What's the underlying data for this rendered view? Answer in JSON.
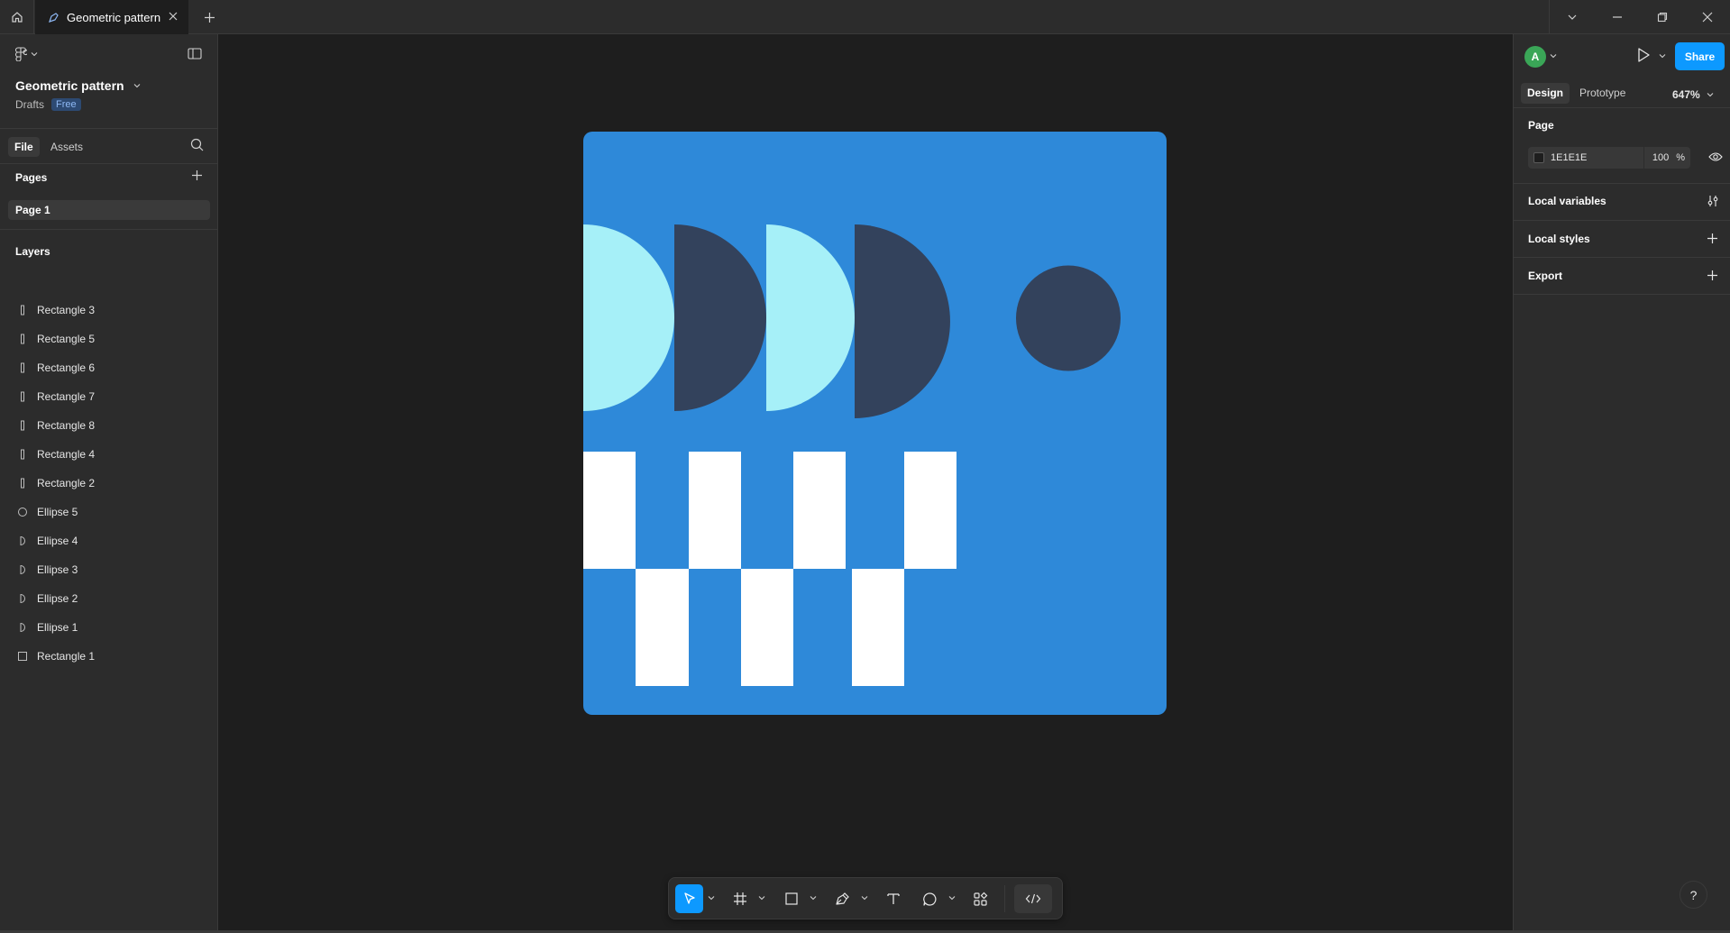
{
  "tabs": {
    "active_title": "Geometric pattern"
  },
  "file": {
    "name": "Geometric pattern",
    "location": "Drafts",
    "plan_badge": "Free"
  },
  "left_tabs": {
    "file": "File",
    "assets": "Assets"
  },
  "pages": {
    "heading": "Pages",
    "items": [
      "Page 1"
    ]
  },
  "layers": {
    "heading": "Layers",
    "items": [
      {
        "name": "Rectangle 3",
        "icon": "rectangle-thin-icon"
      },
      {
        "name": "Rectangle 5",
        "icon": "rectangle-thin-icon"
      },
      {
        "name": "Rectangle 6",
        "icon": "rectangle-thin-icon"
      },
      {
        "name": "Rectangle 7",
        "icon": "rectangle-thin-icon"
      },
      {
        "name": "Rectangle 8",
        "icon": "rectangle-thin-icon"
      },
      {
        "name": "Rectangle 4",
        "icon": "rectangle-thin-icon"
      },
      {
        "name": "Rectangle 2",
        "icon": "rectangle-thin-icon"
      },
      {
        "name": "Ellipse 5",
        "icon": "ellipse-icon"
      },
      {
        "name": "Ellipse 4",
        "icon": "half-ellipse-icon"
      },
      {
        "name": "Ellipse 3",
        "icon": "half-ellipse-icon"
      },
      {
        "name": "Ellipse 2",
        "icon": "half-ellipse-icon"
      },
      {
        "name": "Ellipse 1",
        "icon": "half-ellipse-icon"
      },
      {
        "name": "Rectangle 1",
        "icon": "rectangle-icon"
      }
    ]
  },
  "header": {
    "share_label": "Share",
    "avatar_initial": "A"
  },
  "right_tabs": {
    "design": "Design",
    "prototype": "Prototype",
    "zoom": "647%"
  },
  "page_panel": {
    "heading": "Page",
    "background_hex": "1E1E1E",
    "opacity": "100",
    "opacity_unit": "%"
  },
  "sections": {
    "local_variables": "Local variables",
    "local_styles": "Local styles",
    "export": "Export"
  },
  "help_label": "?",
  "colors": {
    "artboard_blue": "#2e89d9",
    "light_cyan": "#a6f0f8",
    "navy": "#33425c",
    "white": "#ffffff",
    "accent": "#0d99ff"
  }
}
